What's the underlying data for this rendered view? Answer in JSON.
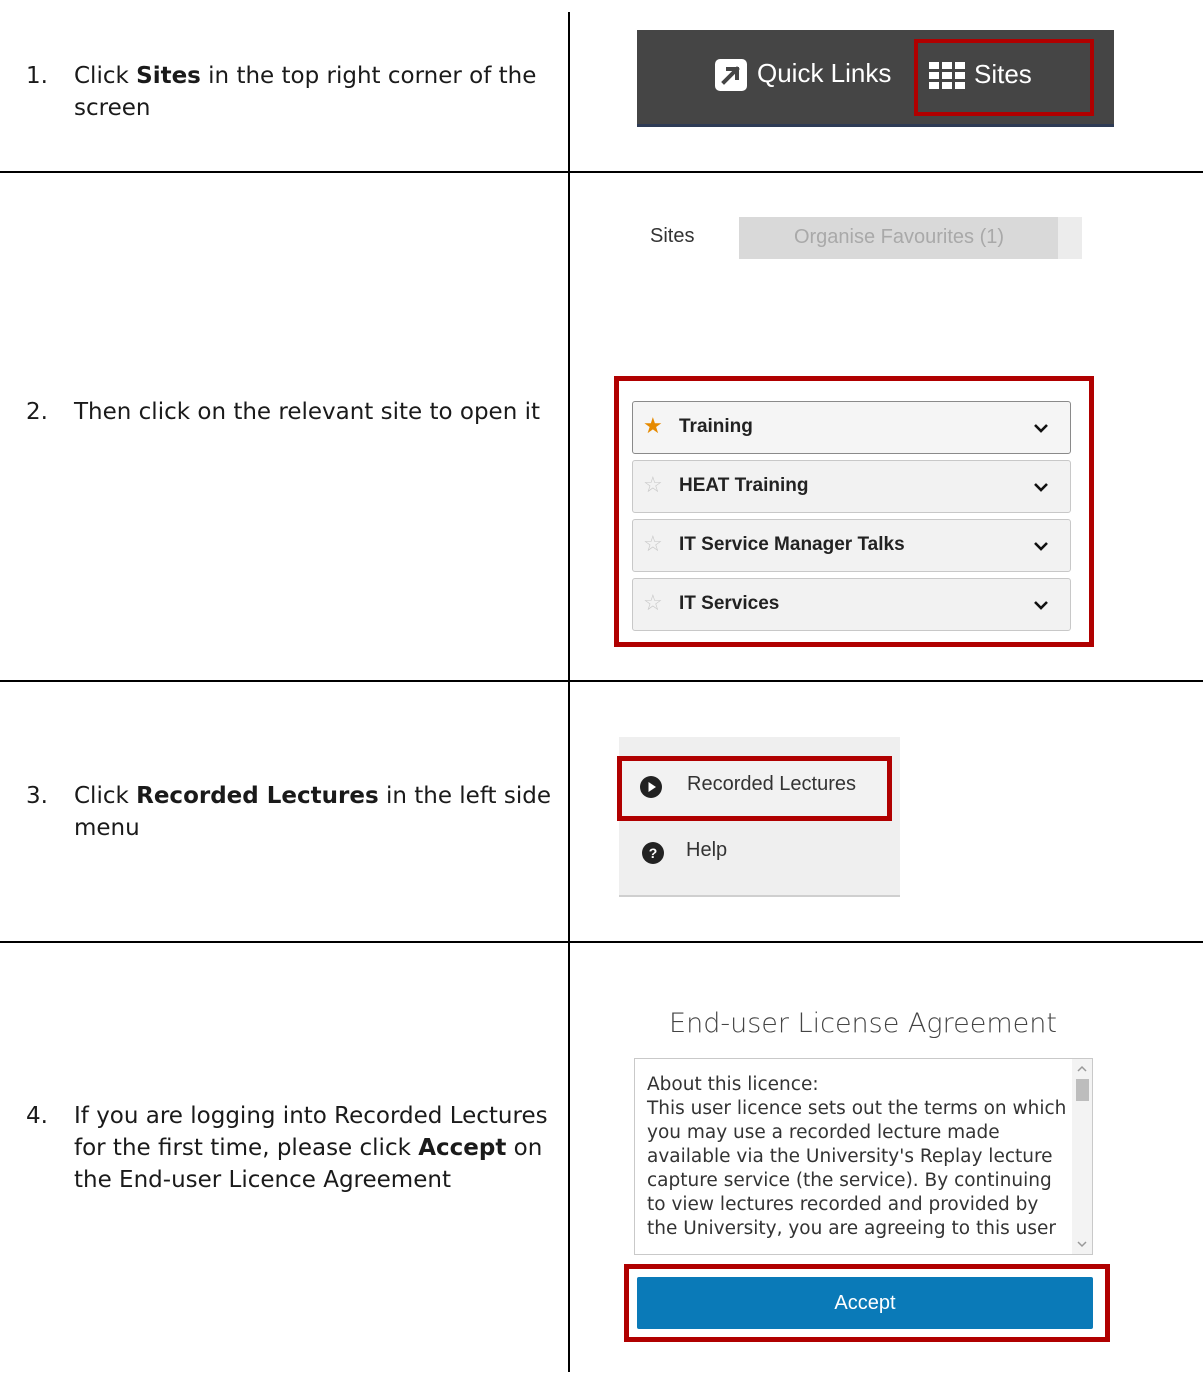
{
  "steps": [
    {
      "number": "1.",
      "parts": [
        "Click ",
        "Sites",
        " in the top right corner of the screen"
      ]
    },
    {
      "number": "2.",
      "text": "Then click on the relevant site to open it"
    },
    {
      "number": "3.",
      "parts": [
        "Click ",
        "Recorded Lectures",
        " in the left side menu"
      ]
    },
    {
      "number": "4.",
      "parts": [
        "If you are logging into Recorded Lectures for the first time, please click ",
        "Accept",
        " on the End-user Licence Agreement"
      ]
    }
  ],
  "topbar": {
    "quick_links": "Quick Links",
    "sites": "Sites"
  },
  "sites_panel": {
    "tab_sites": "Sites",
    "tab_favourites": "Organise Favourites (1)",
    "items": [
      {
        "name": "Training",
        "favourite": true
      },
      {
        "name": "HEAT Training",
        "favourite": false
      },
      {
        "name": "IT Service Manager Talks",
        "favourite": false
      },
      {
        "name": "IT Services",
        "favourite": false
      }
    ]
  },
  "side_menu": {
    "recorded_lectures": "Recorded Lectures",
    "help": "Help"
  },
  "eula": {
    "title": "End-user License Agreement",
    "heading": "About this licence:",
    "body": "This user licence sets out the terms on which you may use a recorded lecture made available via the University's Replay lecture capture service (the service). By continuing to view lectures recorded and provided by the University, you are agreeing to this user",
    "accept": "Accept"
  },
  "colors": {
    "highlight": "#b00000",
    "accept_button": "#0a7ab8",
    "star": "#e68a00",
    "topbar": "#454545"
  }
}
